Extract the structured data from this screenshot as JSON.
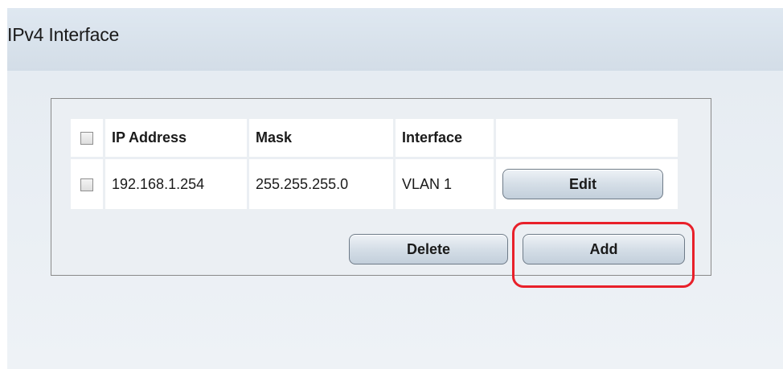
{
  "page": {
    "title": "IPv4 Interface"
  },
  "table": {
    "headers": {
      "ip_address": "IP Address",
      "mask": "Mask",
      "interface": "Interface"
    },
    "rows": [
      {
        "ip_address": "192.168.1.254",
        "mask": "255.255.255.0",
        "interface": "VLAN 1",
        "edit_label": "Edit"
      }
    ]
  },
  "actions": {
    "delete_label": "Delete",
    "add_label": "Add"
  },
  "colors": {
    "highlight": "#e8202a",
    "header_band": "#d3dde7"
  }
}
